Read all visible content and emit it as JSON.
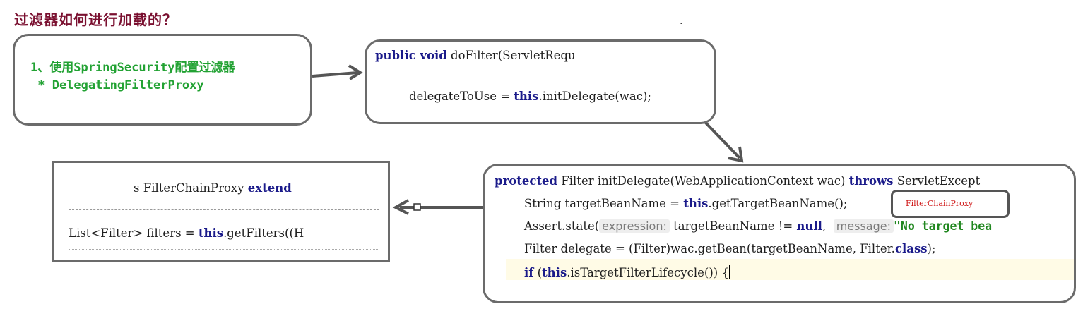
{
  "title": "过滤器如何进行加载的？",
  "dot": ".",
  "box1": {
    "line1": "1、使用SpringSecurity配置过滤器",
    "line2": " * DelegatingFilterProxy"
  },
  "box2": {
    "l1_kw": "public void",
    "l1_rest": " doFilter(ServletRequ",
    "l2_pre": "delegateToUse = ",
    "l2_kw": "this",
    "l2_rest": ".initDelegate(wac);"
  },
  "box3": {
    "l1_pre": "s FilterChainProxy ",
    "l1_kw": "extend",
    "l3_pre": "List<Filter> filters = ",
    "l3_kw": "this",
    "l3_rest": ".getFilters((H"
  },
  "box4": {
    "l1_kw": "protected",
    "l1_mid": " Filter initDelegate(WebApplicationContext wac) ",
    "l1_kw2": "throws",
    "l1_rest": " ServletExcept",
    "l2_pre": "String targetBeanName = ",
    "l2_kw": "this",
    "l2_rest": ".getTargetBeanName();",
    "l3_pre": "Assert.state(",
    "l3_hint1": "expression:",
    "l3_mid": " targetBeanName != ",
    "l3_kw": "null",
    "l3_comma": ",",
    "l3_hint2": "message:",
    "l3_str": "\"No target bea",
    "l4_pre": "Filter delegate = (Filter)wac.getBean(targetBeanName, Filter.",
    "l4_kw": "class",
    "l4_rest": ");",
    "l5_kw": "if",
    "l5_pre": " (",
    "l5_kw2": "this",
    "l5_rest": ".isTargetFilterLifecycle()) {",
    "annotation": "FilterChainProxy"
  },
  "colors": {
    "title": "#7a1030",
    "keyword": "#1a1a8a",
    "green_text": "#22a233",
    "annotation_red": "#d01a1a",
    "border": "#6b6b6b"
  }
}
